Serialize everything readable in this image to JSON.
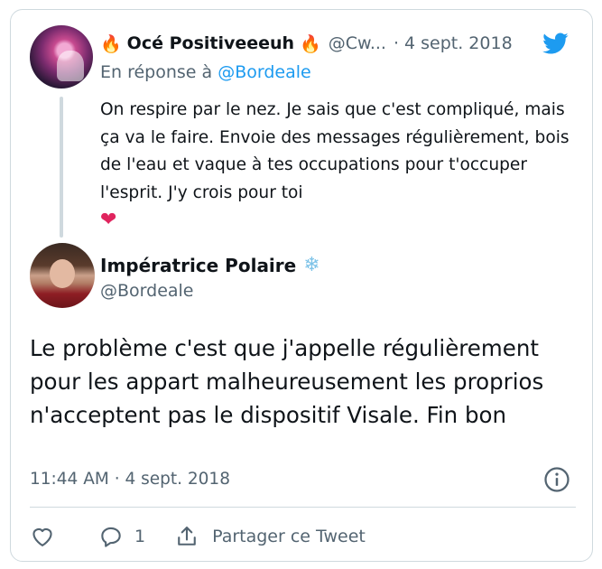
{
  "parent_tweet": {
    "display_name": "Océ Positiveeeuh",
    "name_emoji": "🔥",
    "handle": "@Cw...",
    "separator": "·",
    "date": "4 sept. 2018",
    "reply_prefix": "En réponse à",
    "reply_mention": "@Bordeale",
    "text": "On respire par le nez. Je sais que c'est compliqué, mais ça va le faire. Envoie des messages régulièrement, bois de l'eau et vaque à tes occupations pour t'occuper l'esprit. J'y crois pour toi",
    "trailing_emoji": "❤"
  },
  "main_tweet": {
    "display_name": "Impératrice Polaire",
    "name_emoji": "❄",
    "handle": "@Bordeale",
    "text": "Le problème c'est que j'appelle régulièrement pour les appart malheureusement les proprios n'acceptent pas le dispositif Visale. Fin bon",
    "timestamp": "11:44 AM · 4 sept. 2018"
  },
  "actions": {
    "like_icon": "heart-outline-icon",
    "reply_icon": "speech-bubble-icon",
    "reply_count": "1",
    "share_icon": "share-upload-icon",
    "share_label": "Partager ce Tweet"
  },
  "colors": {
    "accent": "#1d9bf0",
    "secondary_text": "#536471",
    "border": "#cfd9de",
    "heart": "#e0245e"
  }
}
